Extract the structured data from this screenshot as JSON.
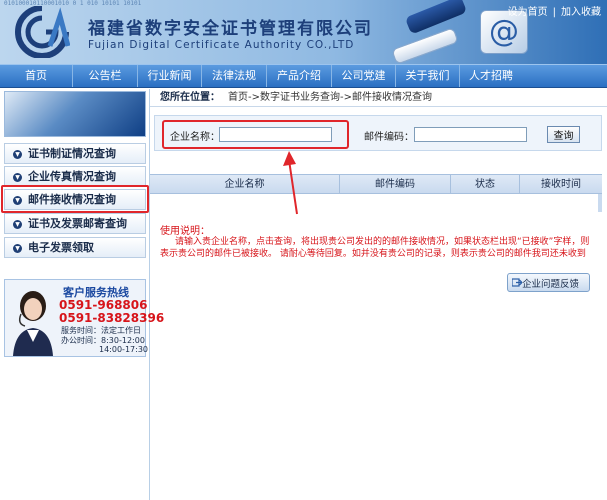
{
  "header": {
    "title_cn": "福建省数字安全证书管理有限公司",
    "title_en": "Fujian Digital Certificate Authority CO.,LTD",
    "binary_deco": "010100010110001010 0 1 010 10101 10101",
    "top_links": [
      "设为首页",
      "加入收藏"
    ],
    "separator": "|"
  },
  "nav": {
    "items": [
      "首页",
      "公告栏",
      "行业新闻",
      "法律法规",
      "产品介绍",
      "公司党建",
      "关于我们",
      "人才招聘"
    ]
  },
  "sidebar": {
    "items": [
      "证书制证情况查询",
      "企业传真情况查询",
      "邮件接收情况查询",
      "证书及发票邮寄查询",
      "电子发票领取"
    ],
    "active_index": 2
  },
  "hotline": {
    "title": "客户服务热线",
    "phone1": "0591-968806",
    "phone2": "0591-83828396",
    "service_label": "服务时间：法定工作日",
    "office_label": "办公时间：8:30-12:00",
    "office_time2": "14:00-17:30"
  },
  "breadcrumb": {
    "prefix": "您所在位置：",
    "path": "首页->数字证书业务查询->邮件接收情况查询"
  },
  "search": {
    "company_label": "企业名称：",
    "company_value": "",
    "mail_label": "邮件编码：",
    "mail_value": "",
    "query_button": "查询"
  },
  "table": {
    "columns": [
      "企业名称",
      "邮件编码",
      "状态",
      "接收时间"
    ]
  },
  "help": {
    "title": "使用说明：",
    "text": "请输入贵企业名称，点击查询，将出现贵公司发出的的邮件接收情况，如果状态栏出现“已接收”字样，则表示贵公司的邮件已被接收。 请耐心等待回复。如并没有贵公司的记录，则表示贵公司的邮件我司还未收到",
    "feedback_button": "企业问题反馈"
  },
  "colors": {
    "annotation_red": "#e0262b",
    "nav_blue": "#2a6fc2",
    "help_red": "#d7141a"
  }
}
